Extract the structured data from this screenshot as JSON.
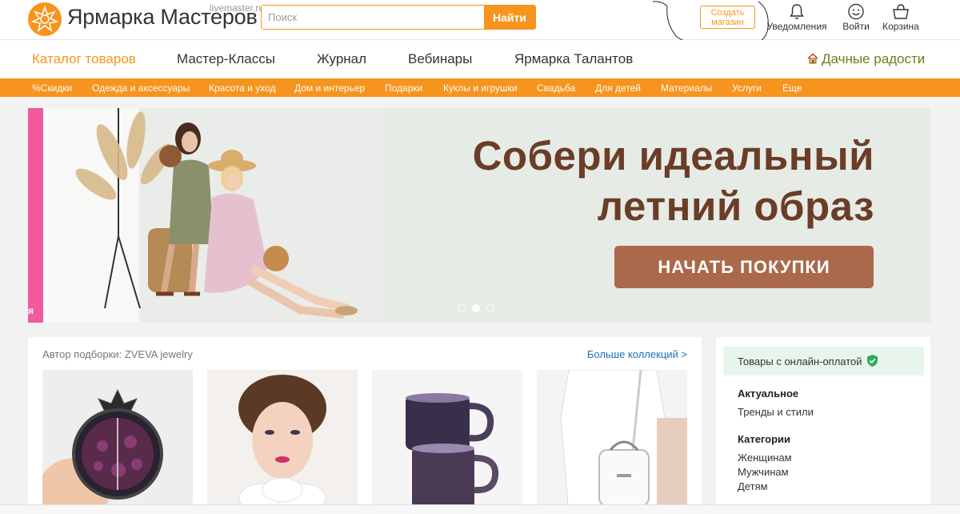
{
  "header": {
    "brand": "Ярмарка Мастеров",
    "domain": "livemaster.ru",
    "search_placeholder": "Поиск",
    "search_button": "Найти",
    "create_shop_line1": "Создать",
    "create_shop_line2": "магазин",
    "notifications": "Уведомления",
    "login": "Войти",
    "cart": "Корзина"
  },
  "main_nav": {
    "items": [
      {
        "label": "Каталог товаров",
        "active": true
      },
      {
        "label": "Мастер-Классы"
      },
      {
        "label": "Журнал"
      },
      {
        "label": "Вебинары"
      },
      {
        "label": "Ярмарка Талантов"
      }
    ],
    "promo": "Дачные радости"
  },
  "categories": [
    "%Скидки",
    "Одежда и аксессуары",
    "Красота и уход",
    "Дом и интерьер",
    "Подарки",
    "Куклы и игрушки",
    "Свадьба",
    "Для детей",
    "Материалы",
    "Услуги",
    "Еще"
  ],
  "banner": {
    "headline_line1": "Собери идеальный",
    "headline_line2": "летний образ",
    "cta": "НАЧАТЬ ПОКУПКИ",
    "side_letter": "я",
    "active_slide": 2,
    "slides": 3
  },
  "collection": {
    "author": "Автор подборки: ZVEVA jewelry",
    "more": "Больше коллекций >"
  },
  "sidebar": {
    "online_payment": "Товары с онлайн-оплатой",
    "actual_heading": "Актуальное",
    "actual_items": [
      "Тренды и стили"
    ],
    "categories_heading": "Категории",
    "category_items": [
      "Женщинам",
      "Мужчинам",
      "Детям"
    ]
  },
  "colors": {
    "accent": "#f7941d",
    "banner_text": "#6b3d28",
    "cta": "#a9694a",
    "link": "#1e6fb5",
    "promo": "#6f7d1e"
  }
}
